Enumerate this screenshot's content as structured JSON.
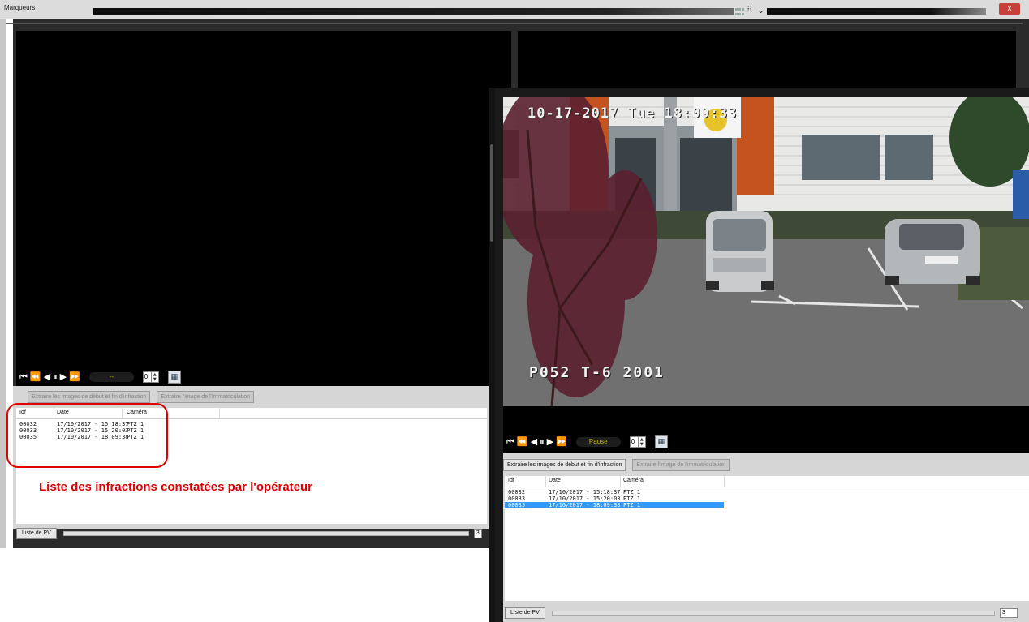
{
  "window": {
    "title": "Marqueurs",
    "close_glyph": "x",
    "chevron_glyph": "⌄",
    "resize_glyph": "⠿"
  },
  "icons": {
    "skip_start": "⏮",
    "fast_back": "⏪",
    "step_back": "◀",
    "pause": "⏸",
    "play": "▶",
    "fast_forward": "⏩",
    "calendar": "▦"
  },
  "left_pane": {
    "speed_label": "--",
    "frame_step": "0",
    "extract_start_end_label": "Extraire les images de début et fin d'infraction",
    "extract_plate_label": "Extraire l'image de l'immatriculation",
    "columns": [
      "Idf",
      "Date",
      "Caméra"
    ],
    "rows": [
      {
        "id": "00032",
        "date": "17/10/2017 - 15:18:37",
        "camera": "PTZ 1"
      },
      {
        "id": "00033",
        "date": "17/10/2017 - 15:20:03",
        "camera": "PTZ 1"
      },
      {
        "id": "00035",
        "date": "17/10/2017 - 18:09:38",
        "camera": "PTZ 1"
      }
    ],
    "pv_button_label": "Liste de PV",
    "pv_count": "3"
  },
  "annotation": {
    "text": "Liste des infractions constatées par l'opérateur",
    "color": "#e00000"
  },
  "right_pane": {
    "overlay_timestamp": "10-17-2017 Tue 18:09:33",
    "overlay_camera": "P052 T-6  2001",
    "speed_label": "Pause",
    "frame_step": "0",
    "extract_start_end_label": "Extraire les images de début et fin d'infraction",
    "extract_plate_label": "Extraire l'image de l'immatriculation",
    "columns": [
      "Idf",
      "Date",
      "Caméra"
    ],
    "rows": [
      {
        "id": "00032",
        "date": "17/10/2017 - 15:18:37",
        "camera": "PTZ 1",
        "selected": false
      },
      {
        "id": "00033",
        "date": "17/10/2017 - 15:20:03",
        "camera": "PTZ 1",
        "selected": false
      },
      {
        "id": "00035",
        "date": "17/10/2017 - 18:09:38",
        "camera": "PTZ 1",
        "selected": true
      }
    ],
    "pv_button_label": "Liste de PV",
    "pv_count": "3"
  },
  "colors": {
    "selection": "#3399ff",
    "speed_text": "#c9b200",
    "close_button": "#c8403a"
  }
}
